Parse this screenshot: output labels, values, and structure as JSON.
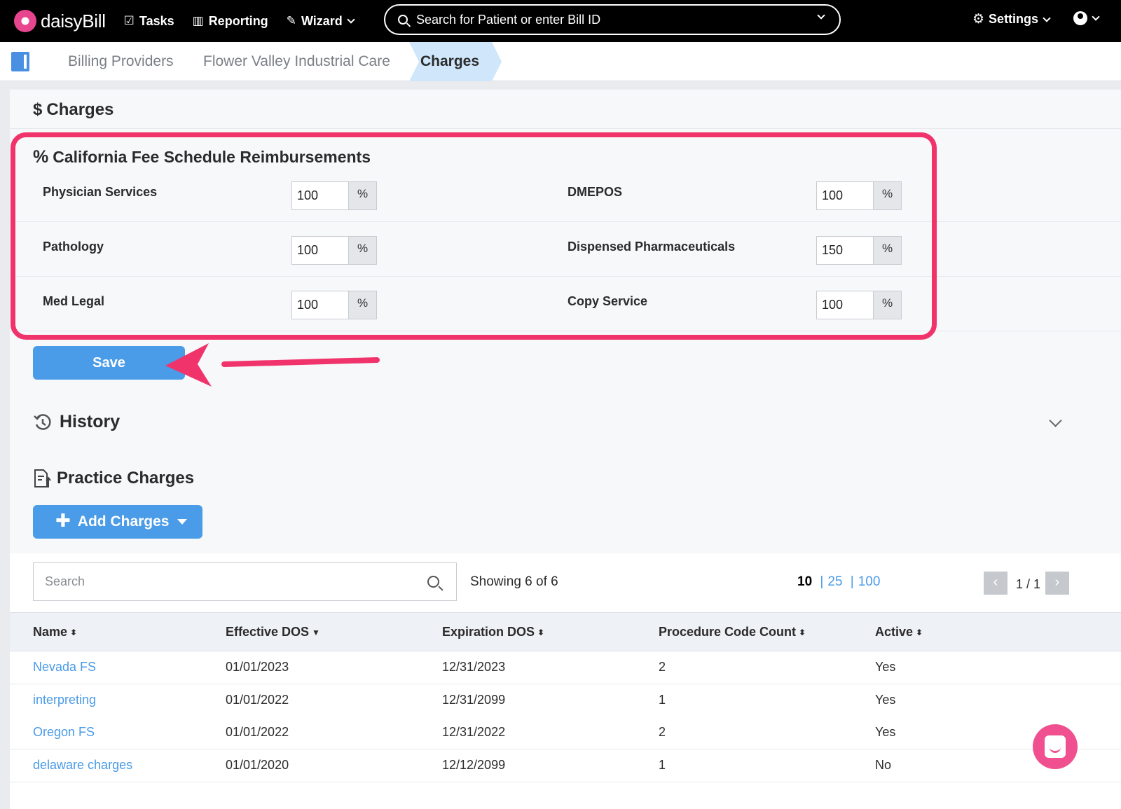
{
  "topbar": {
    "brand": "daisyBill",
    "nav": {
      "tasks": "Tasks",
      "reporting": "Reporting",
      "wizard": "Wizard"
    },
    "search_placeholder": "Search for Patient or enter Bill ID",
    "settings": "Settings"
  },
  "breadcrumb": {
    "items": [
      "Billing Providers",
      "Flower Valley Industrial Care",
      "Charges"
    ]
  },
  "charges": {
    "title": "Charges",
    "fee_schedule": {
      "title": "California Fee Schedule Reimbursements",
      "unit": "%",
      "fields": {
        "physician": {
          "label": "Physician Services",
          "value": "100"
        },
        "dmepos": {
          "label": "DMEPOS",
          "value": "100"
        },
        "pathology": {
          "label": "Pathology",
          "value": "100"
        },
        "pharma": {
          "label": "Dispensed Pharmaceuticals",
          "value": "150"
        },
        "medlegal": {
          "label": "Med Legal",
          "value": "100"
        },
        "copy": {
          "label": "Copy Service",
          "value": "100"
        }
      }
    },
    "save_label": "Save",
    "history_title": "History"
  },
  "practice_charges": {
    "title": "Practice Charges",
    "add_label": "Add Charges",
    "search_placeholder": "Search",
    "showing": "Showing 6 of 6",
    "page_sizes": {
      "current": "10",
      "opt2": "25",
      "opt3": "100"
    },
    "page_count": "1 / 1",
    "columns": {
      "name": "Name",
      "effective": "Effective DOS",
      "expiration": "Expiration DOS",
      "count": "Procedure Code Count",
      "active": "Active"
    },
    "rows": [
      {
        "name": "Nevada FS",
        "effective": "01/01/2023",
        "expiration": "12/31/2023",
        "count": "2",
        "active": "Yes"
      },
      {
        "name": "interpreting",
        "effective": "01/01/2022",
        "expiration": "12/31/2099",
        "count": "1",
        "active": "Yes"
      },
      {
        "name": "Oregon FS",
        "effective": "01/01/2022",
        "expiration": "12/31/2022",
        "count": "2",
        "active": "Yes"
      },
      {
        "name": "delaware charges",
        "effective": "01/01/2020",
        "expiration": "12/12/2099",
        "count": "1",
        "active": "No"
      }
    ]
  },
  "colors": {
    "accent": "#4a9be8",
    "highlight": "#f0336b",
    "topbar": "#000000"
  }
}
